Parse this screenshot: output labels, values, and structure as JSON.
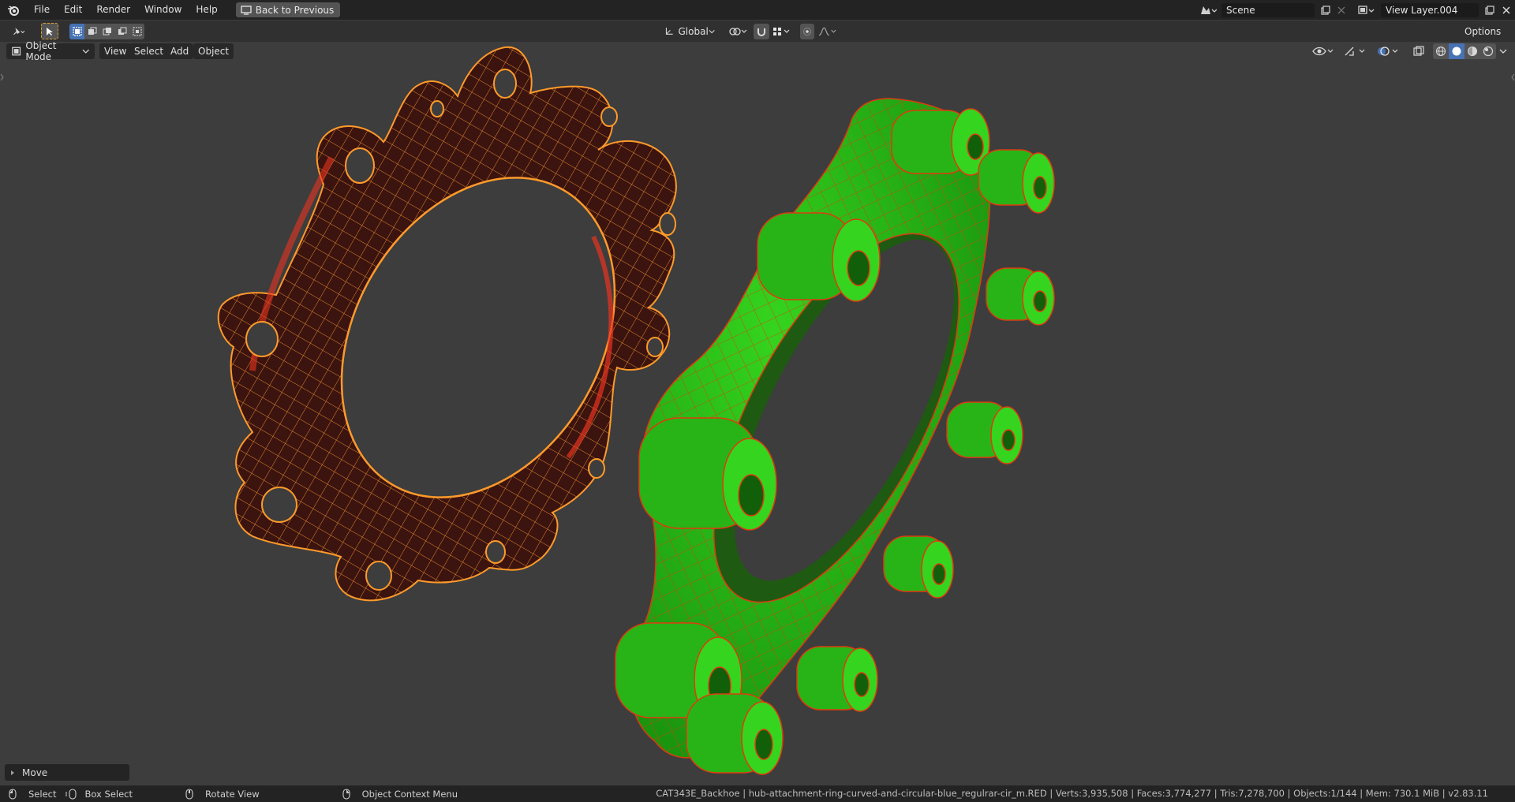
{
  "topbar": {
    "menu": [
      "File",
      "Edit",
      "Render",
      "Window",
      "Help"
    ],
    "back_button": "Back to Previous",
    "scene_name": "Scene",
    "view_layer": "View Layer.004"
  },
  "header": {
    "orientation": "Global",
    "options": "Options"
  },
  "viewport_header": {
    "mode": "Object Mode",
    "menu": [
      "View",
      "Select",
      "Add",
      "Object"
    ]
  },
  "last_operator": "Move",
  "statusbar": {
    "select": "Select",
    "box_select": "Box Select",
    "rotate_view": "Rotate View",
    "context_menu": "Object Context Menu",
    "stats": "CAT343E_Backhoe | hub-attachment-ring-curved-and-circular-blue_regulrar-cir_m.RED | Verts:3,935,508 | Faces:3,774,277 | Tris:7,278,700 | Objects:1/144 | Mem: 730.1 MiB | v2.83.11"
  },
  "colors": {
    "selected_object": "#e8331f",
    "selected_wire": "#ff9a2a",
    "other_object": "#2bbf1a",
    "other_wire": "#e03a10",
    "viewport_bg": "#3d3d3d"
  }
}
